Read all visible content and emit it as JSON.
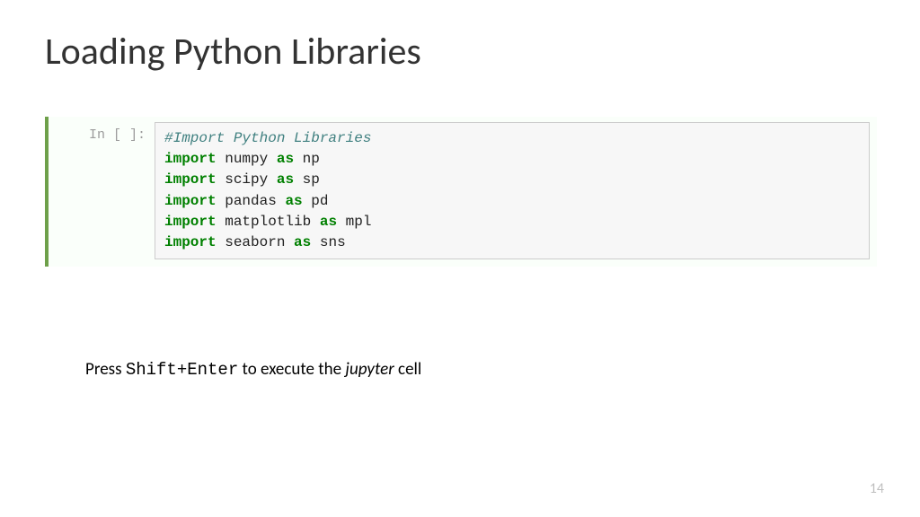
{
  "title": "Loading Python Libraries",
  "cell": {
    "prompt": "In [ ]:",
    "code": {
      "comment": "#Import Python Libraries",
      "lines": [
        {
          "kw1": "import",
          "mod": "numpy",
          "kw2": "as",
          "alias": "np"
        },
        {
          "kw1": "import",
          "mod": "scipy",
          "kw2": "as",
          "alias": "sp"
        },
        {
          "kw1": "import",
          "mod": "pandas",
          "kw2": "as",
          "alias": "pd"
        },
        {
          "kw1": "import",
          "mod": "matplotlib",
          "kw2": "as",
          "alias": "mpl"
        },
        {
          "kw1": "import",
          "mod": "seaborn",
          "kw2": "as",
          "alias": "sns"
        }
      ]
    }
  },
  "instruction": {
    "pre": "Press ",
    "shortcut": "Shift+Enter",
    "mid": " to execute the ",
    "ital": "jupyter",
    "post": " cell"
  },
  "page_number": "14"
}
